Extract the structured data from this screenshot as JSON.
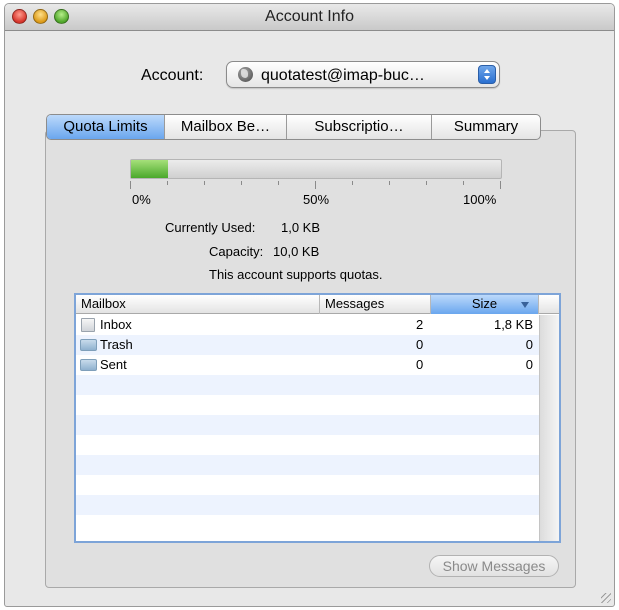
{
  "window": {
    "title": "Account Info"
  },
  "account": {
    "label": "Account:",
    "selected": "quotatest@imap-buc…",
    "icon": "globe-icon"
  },
  "tabs": [
    {
      "label": "Quota Limits",
      "selected": true
    },
    {
      "label": "Mailbox Be…",
      "selected": false
    },
    {
      "label": "Subscriptio…",
      "selected": false
    },
    {
      "label": "Summary",
      "selected": false
    }
  ],
  "quota": {
    "usage_fraction": 0.1,
    "labels": {
      "min": "0%",
      "mid": "50%",
      "max": "100%"
    },
    "currently_used_label": "Currently Used:",
    "currently_used_value": "1,0 KB",
    "capacity_label": "Capacity:",
    "capacity_value": "10,0 KB",
    "support_text": "This account supports quotas.",
    "fill_color": "#4aa82b"
  },
  "table": {
    "columns": {
      "mailbox": "Mailbox",
      "messages": "Messages",
      "size": "Size"
    },
    "sorted_column": "size",
    "rows": [
      {
        "name": "Inbox",
        "messages": "2",
        "size": "1,8 KB",
        "icon": "file-icon"
      },
      {
        "name": "Trash",
        "messages": "0",
        "size": "0",
        "icon": "folder-icon"
      },
      {
        "name": "Sent",
        "messages": "0",
        "size": "0",
        "icon": "folder-icon"
      }
    ]
  },
  "buttons": {
    "show_messages": "Show Messages"
  },
  "colors": {
    "accent": "#6aa6ee",
    "row_alt": "#edf3fe"
  }
}
